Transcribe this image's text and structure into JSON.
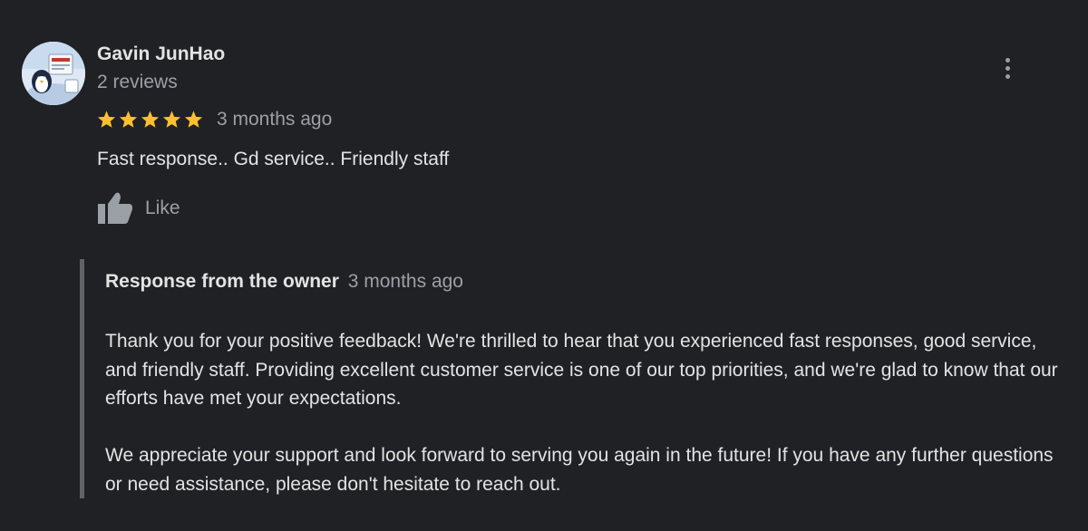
{
  "review": {
    "author": {
      "name": "Gavin JunHao",
      "review_count": "2 reviews",
      "avatar_icon": "user-avatar-icon"
    },
    "rating": 5,
    "rating_max": 5,
    "date": "3 months ago",
    "text": "Fast response.. Gd service.. Friendly staff",
    "like_label": "Like",
    "more_icon": "more-vert-icon"
  },
  "owner_response": {
    "title": "Response from the owner",
    "date": "3 months ago",
    "paragraphs": [
      "Thank you for your positive feedback! We're thrilled to hear that you experienced fast responses, good service, and friendly staff. Providing excellent customer service is one of our top priorities, and we're glad to know that our efforts have met your expectations.",
      "We appreciate your support and look forward to serving you again in the future! If you have any further questions or need assistance, please don't hesitate to reach out."
    ]
  },
  "colors": {
    "background": "#202124",
    "primary_text": "#e3e3e3",
    "secondary_text": "#9aa0a6",
    "star": "#fbc02d",
    "response_border": "#5f6368"
  }
}
